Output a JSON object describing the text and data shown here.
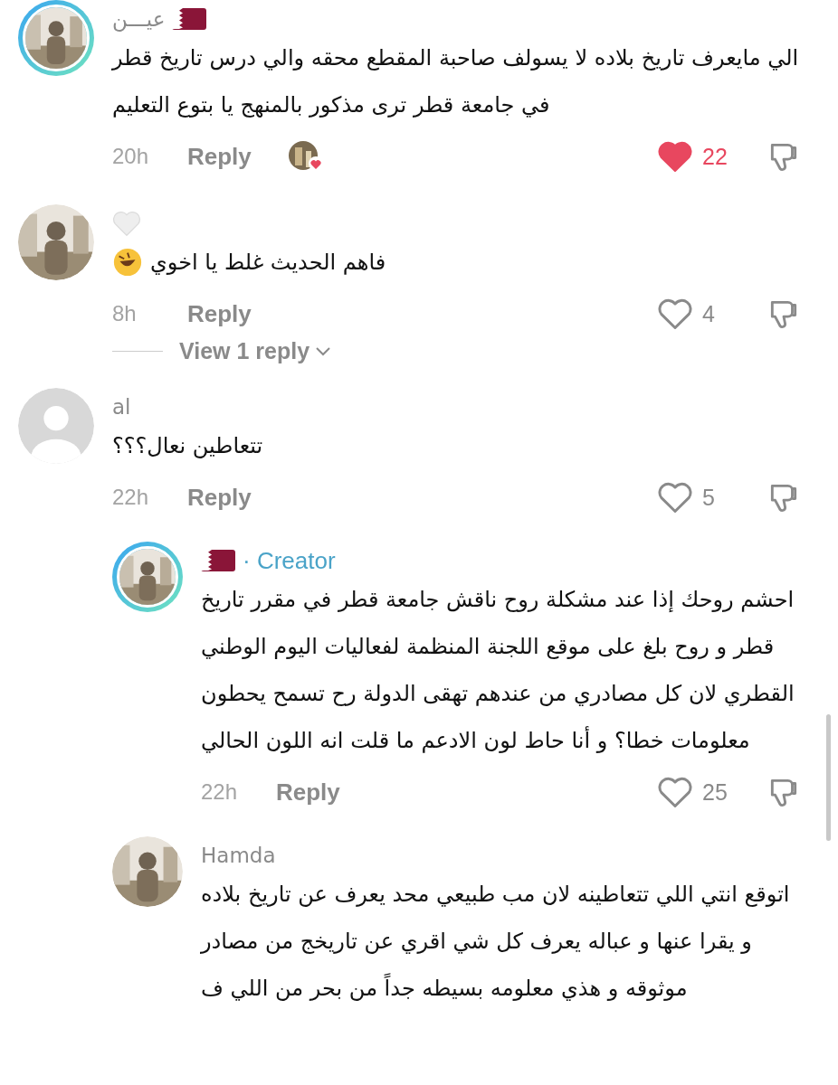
{
  "comments": [
    {
      "avatar": {
        "kind": "picture",
        "ring": true
      },
      "name": "عيـــن",
      "flag": true,
      "text": "الي مايعرف تاريخ بلاده لا يسولف صاحبة المقطع محقه والي درس تاريخ قطر في جامعة قطر ترى مذكور بالمنهج يا بتوع التعليم",
      "actions": {
        "time": "20h",
        "reply": "Reply",
        "creator_liked": true,
        "liked": true,
        "likes": "22"
      }
    },
    {
      "avatar": {
        "kind": "picture"
      },
      "heart_name": true,
      "text": "فاهم الحديث غلط يا اخوي",
      "trailing_emoji": true,
      "actions": {
        "time": "8h",
        "reply": "Reply",
        "liked": false,
        "likes": "4"
      },
      "view_replies": {
        "label": "View 1 reply"
      }
    },
    {
      "avatar": {
        "kind": "default"
      },
      "name": "al",
      "text": "تتعاطين نعال؟؟؟",
      "actions": {
        "time": "22h",
        "reply": "Reply",
        "liked": false,
        "likes": "5"
      },
      "children": [
        {
          "avatar": {
            "kind": "picture",
            "ring": true
          },
          "flag": true,
          "badge": "· Creator",
          "text": "احشم روحك إذا عند مشكلة روح ناقش جامعة قطر في مقرر تاريخ قطر و روح بلغ على موقع اللجنة المنظمة لفعاليات اليوم الوطني القطري لان كل مصادري من عندهم تهقى الدولة رح تسمح يحطون معلومات خطا؟ و أنا حاط لون الادعم ما قلت انه اللون الحالي",
          "actions": {
            "time": "22h",
            "reply": "Reply",
            "liked": false,
            "likes": "25"
          }
        },
        {
          "avatar": {
            "kind": "picture"
          },
          "name": "Hamda",
          "text": "اتوقع انتي اللي تتعاطينه لان مب طبيعي محد يعرف عن تاريخ بلاده و يقرا عنها و عباله يعرف كل شي اقري عن تاريخج من مصادر موثوقه و هذي معلومه بسيطه جداً من بحر من اللي ف"
        }
      ]
    }
  ]
}
